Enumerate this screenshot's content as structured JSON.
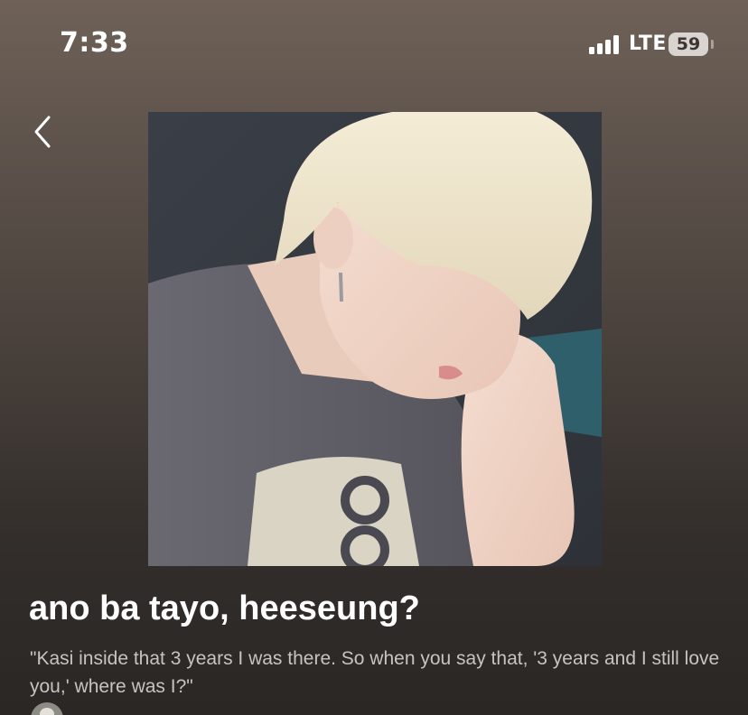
{
  "status_bar": {
    "time": "7:33",
    "network": "LTE",
    "battery": "59"
  },
  "icons": {
    "back": "chevron-left-icon",
    "signal": "cellular-signal-icon",
    "battery": "battery-icon"
  },
  "playlist": {
    "title": "ano ba tayo, heeseung?",
    "description": "\"Kasi inside that 3 years I was there. So when you say that, '3 years and I still love you,' where was I?\""
  },
  "colors": {
    "background_top": "#6e6158",
    "background_bottom": "#2a2725",
    "description_text": "#c9c3bf"
  }
}
